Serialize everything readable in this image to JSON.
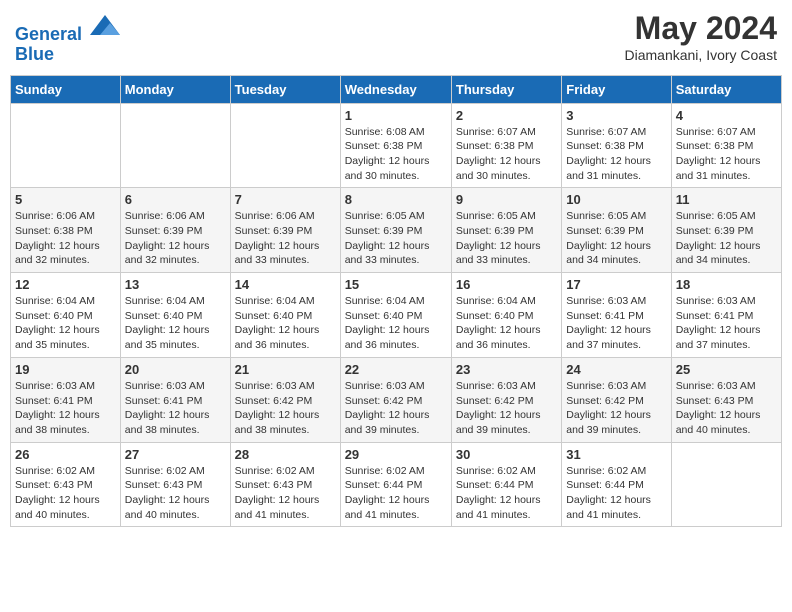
{
  "header": {
    "logo_line1": "General",
    "logo_line2": "Blue",
    "month_title": "May 2024",
    "location": "Diamankani, Ivory Coast"
  },
  "weekdays": [
    "Sunday",
    "Monday",
    "Tuesday",
    "Wednesday",
    "Thursday",
    "Friday",
    "Saturday"
  ],
  "weeks": [
    [
      {
        "day": "",
        "info": ""
      },
      {
        "day": "",
        "info": ""
      },
      {
        "day": "",
        "info": ""
      },
      {
        "day": "1",
        "info": "Sunrise: 6:08 AM\nSunset: 6:38 PM\nDaylight: 12 hours\nand 30 minutes."
      },
      {
        "day": "2",
        "info": "Sunrise: 6:07 AM\nSunset: 6:38 PM\nDaylight: 12 hours\nand 30 minutes."
      },
      {
        "day": "3",
        "info": "Sunrise: 6:07 AM\nSunset: 6:38 PM\nDaylight: 12 hours\nand 31 minutes."
      },
      {
        "day": "4",
        "info": "Sunrise: 6:07 AM\nSunset: 6:38 PM\nDaylight: 12 hours\nand 31 minutes."
      }
    ],
    [
      {
        "day": "5",
        "info": "Sunrise: 6:06 AM\nSunset: 6:38 PM\nDaylight: 12 hours\nand 32 minutes."
      },
      {
        "day": "6",
        "info": "Sunrise: 6:06 AM\nSunset: 6:39 PM\nDaylight: 12 hours\nand 32 minutes."
      },
      {
        "day": "7",
        "info": "Sunrise: 6:06 AM\nSunset: 6:39 PM\nDaylight: 12 hours\nand 33 minutes."
      },
      {
        "day": "8",
        "info": "Sunrise: 6:05 AM\nSunset: 6:39 PM\nDaylight: 12 hours\nand 33 minutes."
      },
      {
        "day": "9",
        "info": "Sunrise: 6:05 AM\nSunset: 6:39 PM\nDaylight: 12 hours\nand 33 minutes."
      },
      {
        "day": "10",
        "info": "Sunrise: 6:05 AM\nSunset: 6:39 PM\nDaylight: 12 hours\nand 34 minutes."
      },
      {
        "day": "11",
        "info": "Sunrise: 6:05 AM\nSunset: 6:39 PM\nDaylight: 12 hours\nand 34 minutes."
      }
    ],
    [
      {
        "day": "12",
        "info": "Sunrise: 6:04 AM\nSunset: 6:40 PM\nDaylight: 12 hours\nand 35 minutes."
      },
      {
        "day": "13",
        "info": "Sunrise: 6:04 AM\nSunset: 6:40 PM\nDaylight: 12 hours\nand 35 minutes."
      },
      {
        "day": "14",
        "info": "Sunrise: 6:04 AM\nSunset: 6:40 PM\nDaylight: 12 hours\nand 36 minutes."
      },
      {
        "day": "15",
        "info": "Sunrise: 6:04 AM\nSunset: 6:40 PM\nDaylight: 12 hours\nand 36 minutes."
      },
      {
        "day": "16",
        "info": "Sunrise: 6:04 AM\nSunset: 6:40 PM\nDaylight: 12 hours\nand 36 minutes."
      },
      {
        "day": "17",
        "info": "Sunrise: 6:03 AM\nSunset: 6:41 PM\nDaylight: 12 hours\nand 37 minutes."
      },
      {
        "day": "18",
        "info": "Sunrise: 6:03 AM\nSunset: 6:41 PM\nDaylight: 12 hours\nand 37 minutes."
      }
    ],
    [
      {
        "day": "19",
        "info": "Sunrise: 6:03 AM\nSunset: 6:41 PM\nDaylight: 12 hours\nand 38 minutes."
      },
      {
        "day": "20",
        "info": "Sunrise: 6:03 AM\nSunset: 6:41 PM\nDaylight: 12 hours\nand 38 minutes."
      },
      {
        "day": "21",
        "info": "Sunrise: 6:03 AM\nSunset: 6:42 PM\nDaylight: 12 hours\nand 38 minutes."
      },
      {
        "day": "22",
        "info": "Sunrise: 6:03 AM\nSunset: 6:42 PM\nDaylight: 12 hours\nand 39 minutes."
      },
      {
        "day": "23",
        "info": "Sunrise: 6:03 AM\nSunset: 6:42 PM\nDaylight: 12 hours\nand 39 minutes."
      },
      {
        "day": "24",
        "info": "Sunrise: 6:03 AM\nSunset: 6:42 PM\nDaylight: 12 hours\nand 39 minutes."
      },
      {
        "day": "25",
        "info": "Sunrise: 6:03 AM\nSunset: 6:43 PM\nDaylight: 12 hours\nand 40 minutes."
      }
    ],
    [
      {
        "day": "26",
        "info": "Sunrise: 6:02 AM\nSunset: 6:43 PM\nDaylight: 12 hours\nand 40 minutes."
      },
      {
        "day": "27",
        "info": "Sunrise: 6:02 AM\nSunset: 6:43 PM\nDaylight: 12 hours\nand 40 minutes."
      },
      {
        "day": "28",
        "info": "Sunrise: 6:02 AM\nSunset: 6:43 PM\nDaylight: 12 hours\nand 41 minutes."
      },
      {
        "day": "29",
        "info": "Sunrise: 6:02 AM\nSunset: 6:44 PM\nDaylight: 12 hours\nand 41 minutes."
      },
      {
        "day": "30",
        "info": "Sunrise: 6:02 AM\nSunset: 6:44 PM\nDaylight: 12 hours\nand 41 minutes."
      },
      {
        "day": "31",
        "info": "Sunrise: 6:02 AM\nSunset: 6:44 PM\nDaylight: 12 hours\nand 41 minutes."
      },
      {
        "day": "",
        "info": ""
      }
    ]
  ]
}
